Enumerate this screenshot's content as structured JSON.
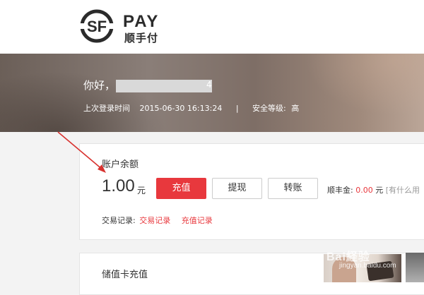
{
  "brand": {
    "logo_mark": "SF",
    "name": "PAY",
    "name_cn": "顺手付"
  },
  "banner": {
    "greeting": "你好，",
    "name_tail": "4",
    "last_login_label": "上次登录时间",
    "last_login_time": "2015-06-30 16:13:24",
    "separator": "|",
    "security_label": "安全等级:",
    "security_level": "高"
  },
  "account": {
    "title": "账户余额",
    "balance": "1.00",
    "unit": "元",
    "buttons": {
      "recharge": "充值",
      "withdraw": "提现",
      "transfer": "转账"
    },
    "fund_label": "顺丰金:",
    "fund_amount": "0.00",
    "fund_unit": "元",
    "fund_hint": "[有什么用"
  },
  "records": {
    "label": "交易记录:",
    "link_trade": "交易记录",
    "link_recharge": "充值记录"
  },
  "stored_value_card": {
    "title": "储值卡充值"
  },
  "watermark": {
    "text": "Bai経验",
    "sub": "jingyan.baidu.com"
  },
  "colors": {
    "accent_red": "#e8383d",
    "arrow_red": "#d8322f"
  }
}
